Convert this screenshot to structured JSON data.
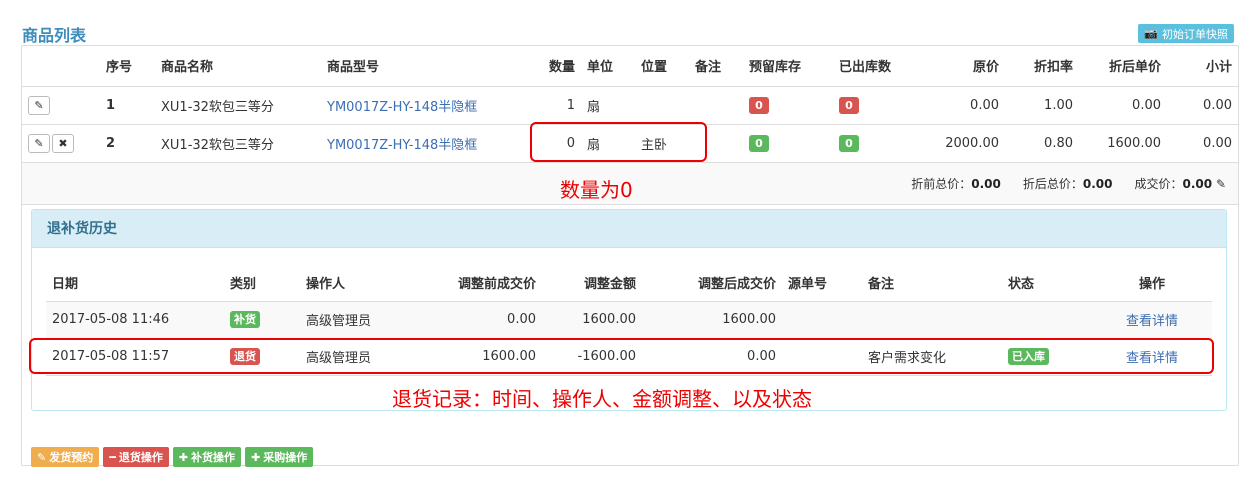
{
  "title": "商品列表",
  "snapshot_btn": "初始订单快照",
  "goods": {
    "headers": [
      "序号",
      "商品名称",
      "商品型号",
      "数量",
      "单位",
      "位置",
      "备注",
      "预留库存",
      "已出库数",
      "原价",
      "折扣率",
      "折后单价",
      "小计"
    ],
    "rows": [
      {
        "seq": "1",
        "name": "XU1-32软包三等分",
        "model": "YM0017Z-HY-148半隐框",
        "qty": "1",
        "unit": "扇",
        "location": "",
        "note": "",
        "reserved": "0",
        "shipped": "0",
        "price": "0.00",
        "discount": "1.00",
        "unit_after": "0.00",
        "subtotal": "0.00"
      },
      {
        "seq": "2",
        "name": "XU1-32软包三等分",
        "model": "YM0017Z-HY-148半隐框",
        "qty": "0",
        "unit": "扇",
        "location": "主卧",
        "note": "",
        "reserved": "0",
        "shipped": "0",
        "price": "2000.00",
        "discount": "0.80",
        "unit_after": "1600.00",
        "subtotal": "0.00"
      }
    ],
    "icons": {
      "edit": "pencil-icon",
      "delete": "close-icon"
    }
  },
  "totals": {
    "before_label": "折前总价：",
    "before": "0.00",
    "after_label": "折后总价：",
    "after": "0.00",
    "deal_label": "成交价：",
    "deal": "0.00"
  },
  "annotation_qty": "数量为0",
  "history": {
    "title": "退补货历史",
    "headers": [
      "日期",
      "类别",
      "操作人",
      "调整前成交价",
      "调整金额",
      "调整后成交价",
      "源单号",
      "备注",
      "状态",
      "操作"
    ],
    "rows": [
      {
        "date": "2017-05-08 11:46",
        "type": "补货",
        "operator": "高级管理员",
        "before": "0.00",
        "amount": "1600.00",
        "after": "1600.00",
        "source": "",
        "note": "",
        "status": "",
        "action": "查看详情"
      },
      {
        "date": "2017-05-08 11:57",
        "type": "退货",
        "operator": "高级管理员",
        "before": "1600.00",
        "amount": "-1600.00",
        "after": "0.00",
        "source": "",
        "note": "客户需求变化",
        "status": "已入库",
        "action": "查看详情"
      }
    ]
  },
  "annotation_history": "退货记录：时间、操作人、金额调整、以及状态",
  "footer": {
    "ship": "发货预约",
    "return": "退货操作",
    "restock": "补货操作",
    "purchase": "采购操作"
  },
  "colors": {
    "accent": "#3c8dbc",
    "danger": "#d9534f",
    "success": "#5cb85c",
    "warning": "#f0ad4e",
    "info": "#5bc0de",
    "annotation": "#e00000"
  }
}
